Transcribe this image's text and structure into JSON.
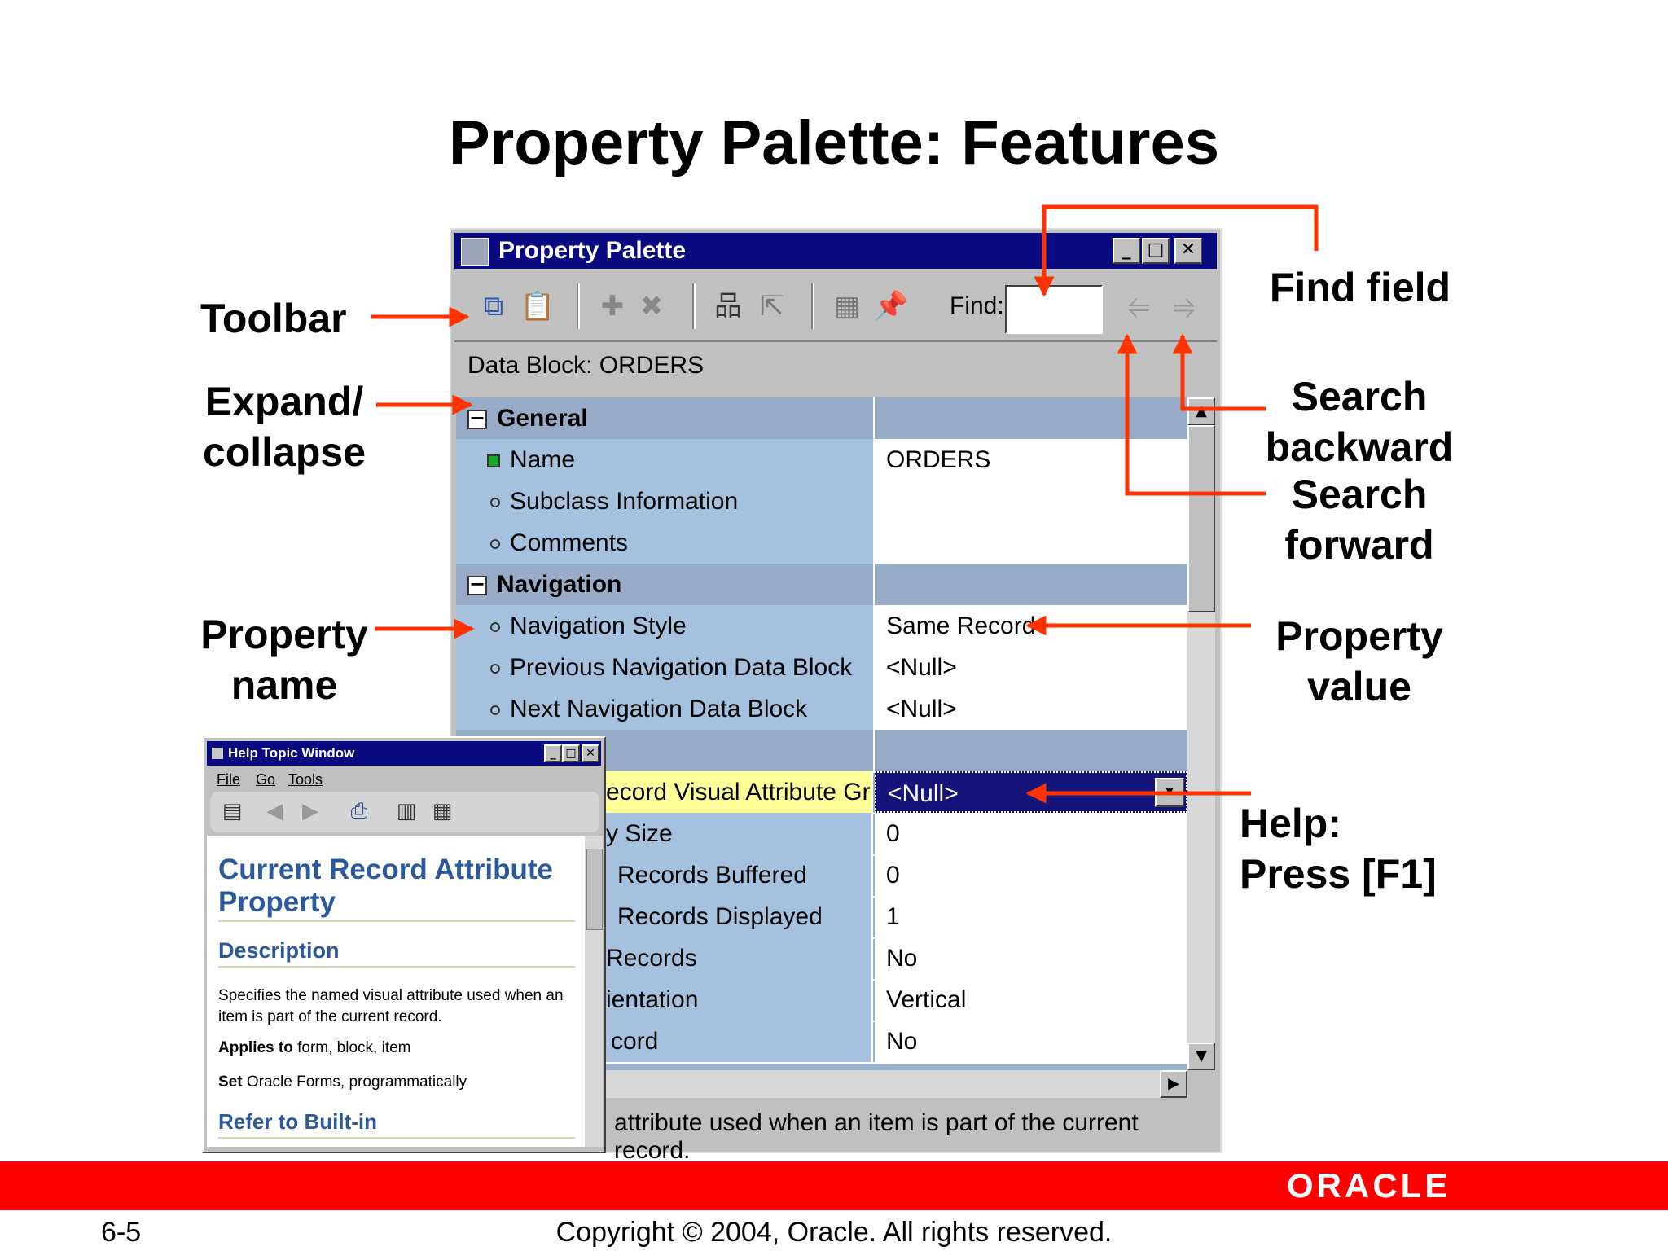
{
  "slide": {
    "title": "Property Palette: Features",
    "page_number": "6-5",
    "copyright": "Copyright © 2004, Oracle.  All rights reserved.",
    "logo": "ORACLE",
    "colors": {
      "footer_bar": "#ff0000",
      "callout_arrow": "#ff3300"
    }
  },
  "callouts": {
    "toolbar": "Toolbar",
    "expand_1": "Expand/",
    "expand_2": "collapse",
    "propname_1": "Property",
    "propname_2": "name",
    "find_field": "Find field",
    "search_backward_1": "Search",
    "search_backward_2": "backward",
    "search_forward_1": "Search",
    "search_forward_2": "forward",
    "propvalue_1": "Property",
    "propvalue_2": "value",
    "help_1": "Help:",
    "help_2": "Press [F1]"
  },
  "palette": {
    "title": "Property Palette",
    "find_label": "Find:",
    "context": "Data Block: ORDERS",
    "status_text": "attribute used when an item is part of the current record.",
    "rows": [
      {
        "name": "General",
        "value": ""
      },
      {
        "name": "Name",
        "value": "ORDERS"
      },
      {
        "name": "Subclass Information",
        "value": ""
      },
      {
        "name": "Comments",
        "value": ""
      },
      {
        "name": "Navigation",
        "value": ""
      },
      {
        "name": "Navigation Style",
        "value": "Same Record"
      },
      {
        "name": "Previous Navigation Data Block",
        "value": "<Null>"
      },
      {
        "name": "Next Navigation Data Block",
        "value": "<Null>"
      },
      {
        "name": "",
        "value": ""
      },
      {
        "name": "ecord Visual Attribute Group",
        "value": "<Null>"
      },
      {
        "name": "y Size",
        "value": "0"
      },
      {
        "name": "Records Buffered",
        "value": "0"
      },
      {
        "name": "Records Displayed",
        "value": "1"
      },
      {
        "name": "Records",
        "value": "No"
      },
      {
        "name": "ientation",
        "value": "Vertical"
      },
      {
        "name": "cord",
        "value": "No"
      }
    ]
  },
  "help": {
    "title": "Help Topic Window",
    "menu": [
      "File",
      "Go",
      "Tools"
    ],
    "heading": "Current Record Attribute Property",
    "description_heading": "Description",
    "description": "Specifies the named visual attribute used when an item is part of the current record.",
    "applies_label": "Applies to",
    "applies_value": " form, block, item",
    "set_label": "Set",
    "set_value": " Oracle Forms, programmatically",
    "refer_heading": "Refer to Built-in"
  }
}
